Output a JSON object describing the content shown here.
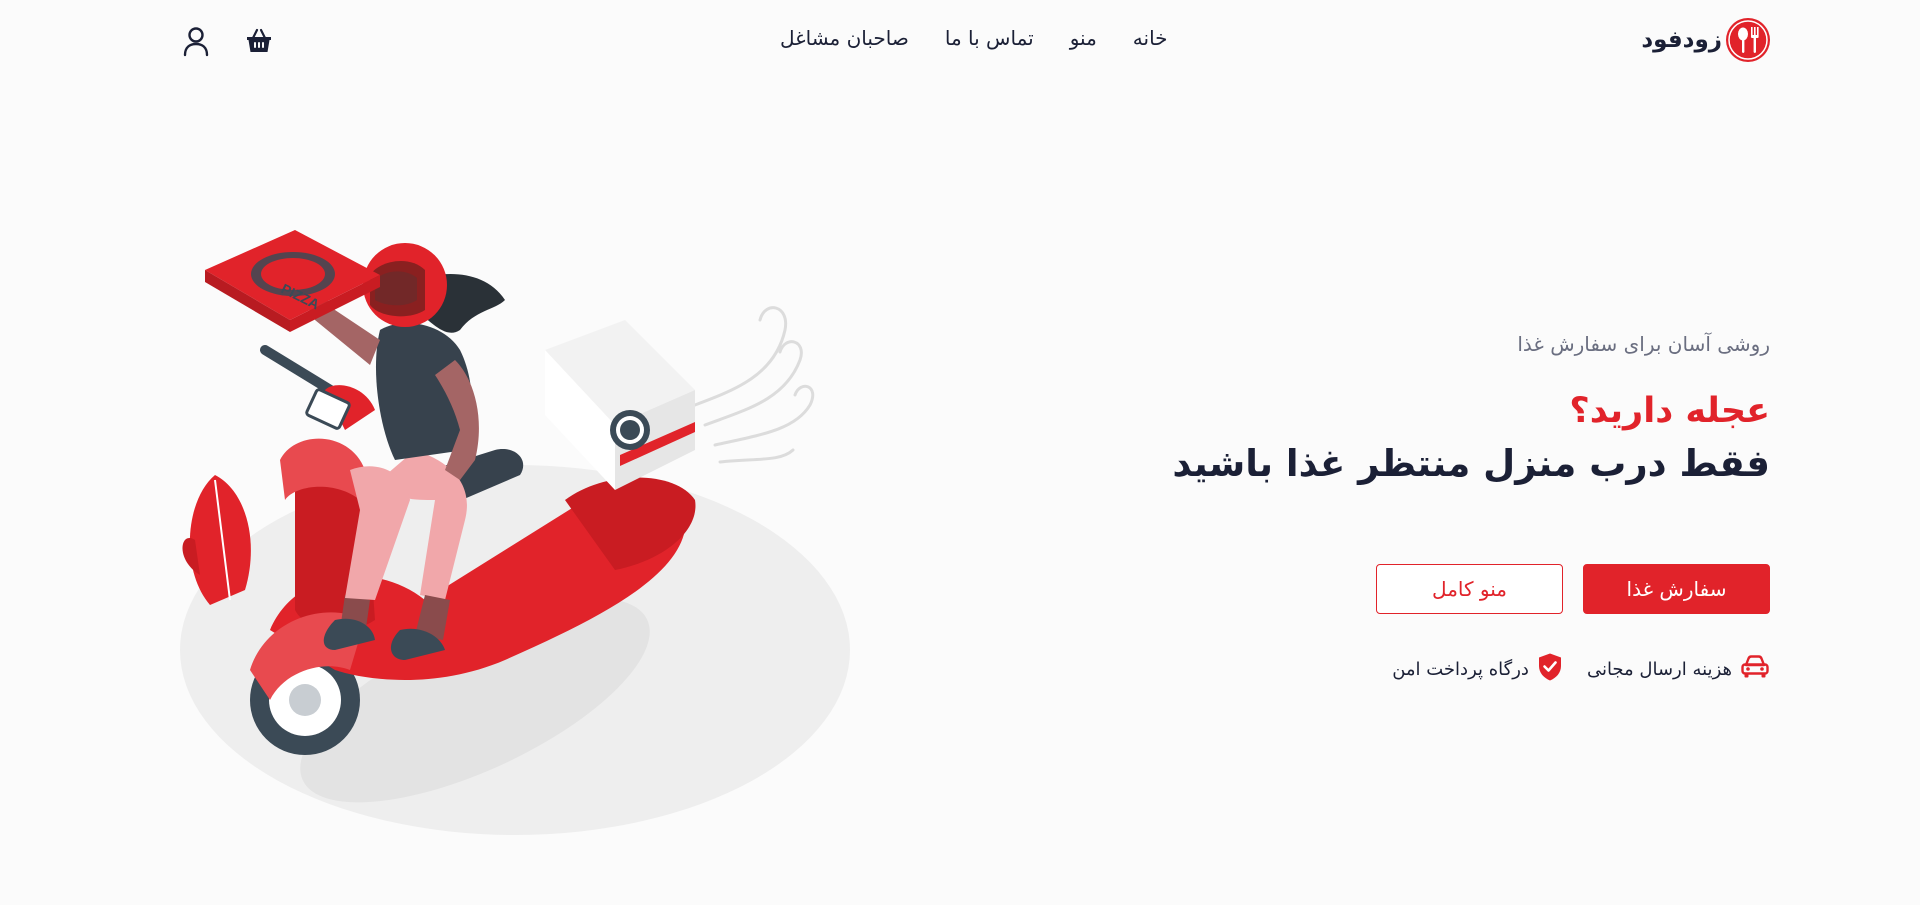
{
  "brand": {
    "name": "زودفود",
    "accent_color": "#e1232a",
    "dark_color": "#1b2036"
  },
  "nav": {
    "items": [
      "خانه",
      "منو",
      "تماس با ما",
      "صاحبان مشاغل"
    ]
  },
  "header_icons": {
    "cart_icon": "basket-icon",
    "user_icon": "user-icon"
  },
  "hero": {
    "tagline": "روشی آسان برای سفارش غذا",
    "title_red": "عجله دارید؟",
    "title_dark": "فقط درب منزل منتظر غذا باشید",
    "primary_button": "سفارش غذا",
    "secondary_button": "منو کامل"
  },
  "features": [
    {
      "label": "هزینه ارسال مجانی",
      "icon": "car-icon"
    },
    {
      "label": "درگاه پرداخت امن",
      "icon": "shield-check-icon"
    }
  ],
  "illustration": {
    "box_text": "PIZZA",
    "icon": "delivery-scooter-illustration"
  }
}
